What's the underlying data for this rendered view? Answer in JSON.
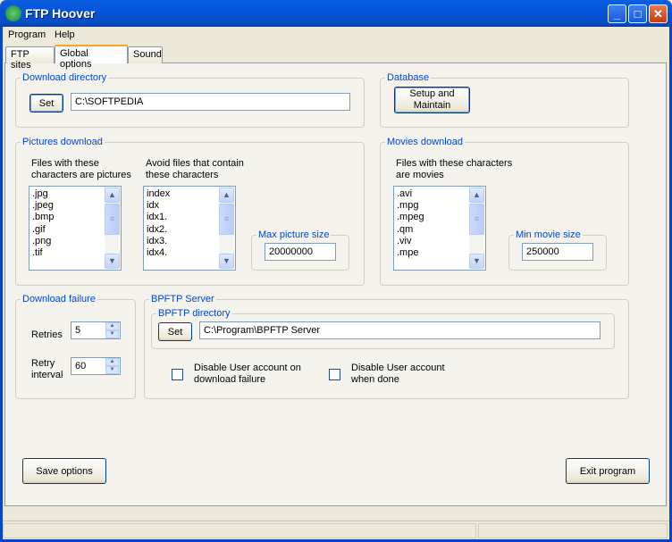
{
  "window": {
    "title": "FTP Hoover",
    "minimize": "_",
    "maximize": "□",
    "close": "✕"
  },
  "menu": [
    "Program",
    "Help"
  ],
  "tabs": [
    "FTP sites",
    "Global options",
    "Sound"
  ],
  "download_directory": {
    "label": "Download directory",
    "set": "Set",
    "value": "C:\\SOFTPEDIA"
  },
  "database": {
    "label": "Database",
    "button": "Setup and Maintain"
  },
  "pictures": {
    "label": "Pictures download",
    "include_label": "Files with these characters are pictures",
    "include": [
      ".jpg",
      ".jpeg",
      ".bmp",
      ".gif",
      ".png",
      ".tif"
    ],
    "avoid_label": "Avoid files that contain these characters",
    "avoid": [
      "index",
      "idx",
      "idx1.",
      "idx2.",
      "idx3.",
      "idx4."
    ],
    "max_label": "Max picture size",
    "max_value": "20000000"
  },
  "movies": {
    "label": "Movies download",
    "include_label": "Files with these characters are  movies",
    "include": [
      ".avi",
      ".mpg",
      ".mpeg",
      ".qm",
      ".viv",
      ".mpe"
    ],
    "min_label": "Min movie size",
    "min_value": "250000"
  },
  "failure": {
    "label": "Download failure",
    "retries_label": "Retries",
    "retries": "5",
    "interval_label": "Retry interval",
    "interval": "60"
  },
  "bpftp": {
    "label": "BPFTP Server",
    "dir_label": "BPFTP directory",
    "set": "Set",
    "dir": "C:\\Program\\BPFTP Server",
    "disable_failure": "Disable User account on download failure",
    "disable_done": "Disable User account when done"
  },
  "footer": {
    "save": "Save options",
    "exit": "Exit program"
  }
}
